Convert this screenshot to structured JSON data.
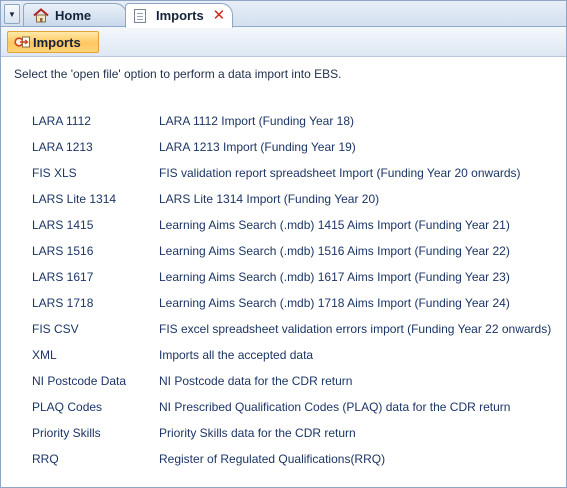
{
  "tabs": {
    "home_label": "Home",
    "imports_label": "Imports",
    "close_glyph": "✕"
  },
  "ribbon": {
    "imports_button_label": "Imports"
  },
  "content": {
    "instructions": "Select the 'open file' option to perform a data import into EBS.",
    "imports": [
      {
        "name": "LARA 1112",
        "description": "LARA 1112 Import (Funding Year 18)"
      },
      {
        "name": "LARA 1213",
        "description": "LARA 1213 Import (Funding Year 19)"
      },
      {
        "name": "FIS XLS",
        "description": "FIS validation report spreadsheet Import (Funding Year 20 onwards)"
      },
      {
        "name": "LARS Lite 1314",
        "description": "LARS Lite 1314 Import (Funding Year 20)"
      },
      {
        "name": "LARS 1415",
        "description": "Learning Aims Search (.mdb) 1415 Aims Import (Funding Year 21)"
      },
      {
        "name": "LARS 1516",
        "description": "Learning Aims Search (.mdb) 1516 Aims Import (Funding Year 22)"
      },
      {
        "name": "LARS 1617",
        "description": "Learning Aims Search (.mdb) 1617 Aims Import (Funding Year 23)"
      },
      {
        "name": "LARS 1718",
        "description": "Learning Aims Search (.mdb) 1718 Aims Import (Funding Year 24)"
      },
      {
        "name": "FIS CSV",
        "description": "FIS excel spreadsheet validation errors import (Funding Year 22 onwards)"
      },
      {
        "name": "XML",
        "description": "Imports all the accepted data"
      },
      {
        "name": "NI Postcode Data",
        "description": "NI Postcode data for the CDR return"
      },
      {
        "name": "PLAQ Codes",
        "description": "NI Prescribed Qualification Codes (PLAQ) data for the CDR return"
      },
      {
        "name": "Priority Skills",
        "description": "Priority Skills data for the CDR return"
      },
      {
        "name": "RRQ",
        "description": "Register of Regulated Qualifications(RRQ)"
      }
    ]
  },
  "icons": {
    "tab_dropdown": "chevron-down-icon",
    "home": "home-icon",
    "imports_tab": "document-icon",
    "close": "close-icon",
    "imports_button": "import-icon"
  },
  "colors": {
    "text_link": "#1c3566",
    "close_red": "#d0281c",
    "ribbon_button": "#ffc660",
    "frame_border": "#8ea6c4"
  }
}
